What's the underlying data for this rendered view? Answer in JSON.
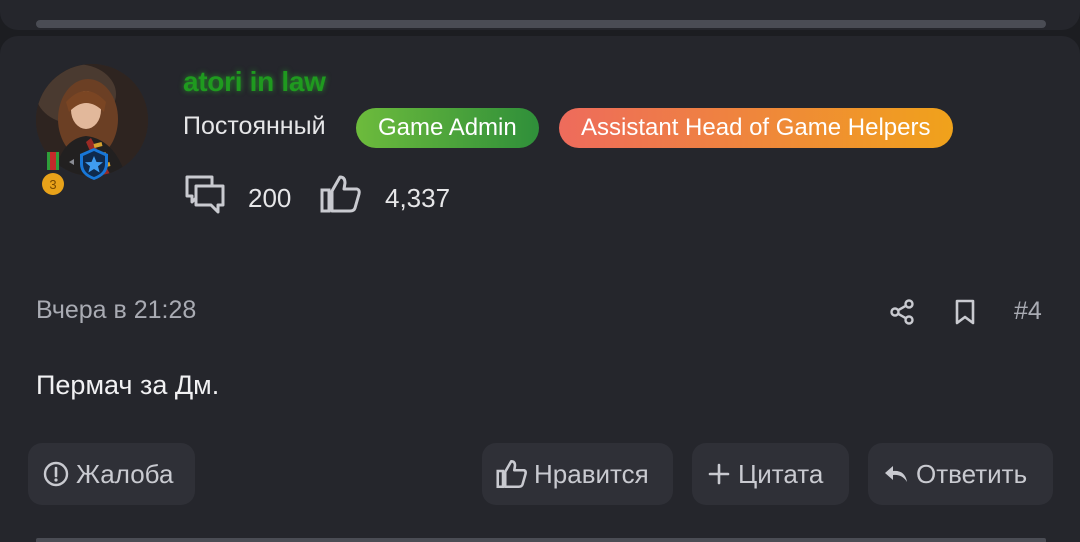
{
  "post": {
    "author": {
      "username": "atori in law",
      "rank": "Постоянный",
      "badges": [
        "Game Admin",
        "Assistant Head of Game Helpers"
      ],
      "username_color": "#1f9a1f",
      "medal_number": "3"
    },
    "stats": {
      "messages": "200",
      "likes": "4,337",
      "messages_icon": "comments-icon",
      "likes_icon": "thumbs-up-icon"
    },
    "date": "Вчера в 21:28",
    "number": "#4",
    "text": "Пермач за Дм."
  },
  "actions": {
    "report": "Жалоба",
    "like": "Нравится",
    "quote": "Цитата",
    "reply": "Ответить"
  },
  "colors": {
    "background": "#1c1d21",
    "card": "#25262c",
    "button": "#2f3037",
    "badge_admin": [
      "#6dbb3c",
      "#2f8f3a"
    ],
    "badge_helpers": [
      "#ee6b5c",
      "#f0a21b"
    ]
  }
}
